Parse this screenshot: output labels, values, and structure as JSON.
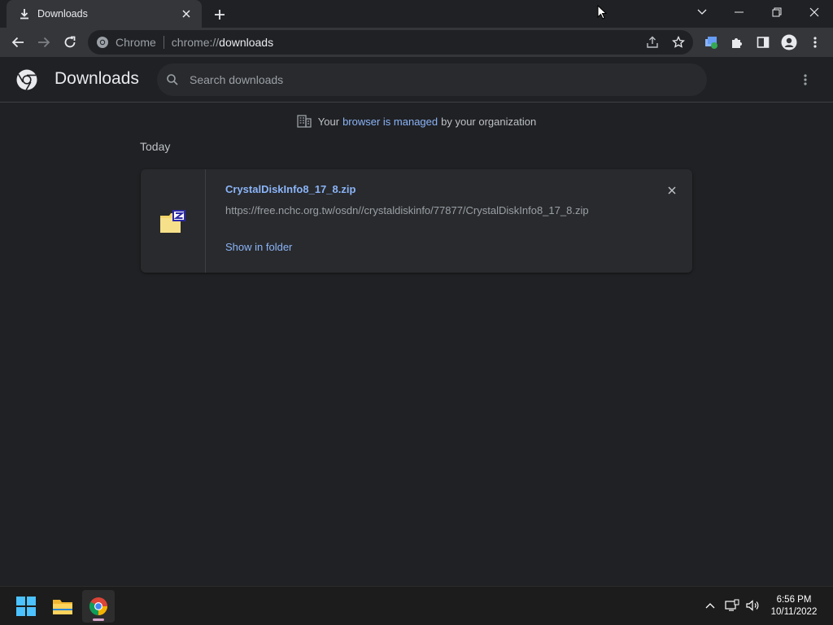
{
  "window": {
    "tab_title": "Downloads",
    "tab_icon": "download-icon"
  },
  "toolbar": {
    "site_chip": "Chrome",
    "url_scheme": "chrome://",
    "url_host": "downloads"
  },
  "downloads": {
    "title": "Downloads",
    "search_placeholder": "Search downloads",
    "managed": {
      "prefix": "Your",
      "link": "browser is managed",
      "suffix": "by your organization"
    },
    "section_date": "Today",
    "items": [
      {
        "file_name": "CrystalDiskInfo8_17_8.zip",
        "url": "https://free.nchc.org.tw/osdn//crystaldiskinfo/77877/CrystalDiskInfo8_17_8.zip",
        "action": "Show in folder",
        "file_icon": "zip-folder-icon"
      }
    ]
  },
  "taskbar": {
    "time": "6:56 PM",
    "date": "10/11/2022",
    "apps": [
      "windows-start-icon",
      "file-explorer-icon",
      "chrome-icon"
    ]
  },
  "colors": {
    "background": "#202124",
    "toolbar": "#35363a",
    "link": "#8ab4f8",
    "card": "#292a2d"
  }
}
